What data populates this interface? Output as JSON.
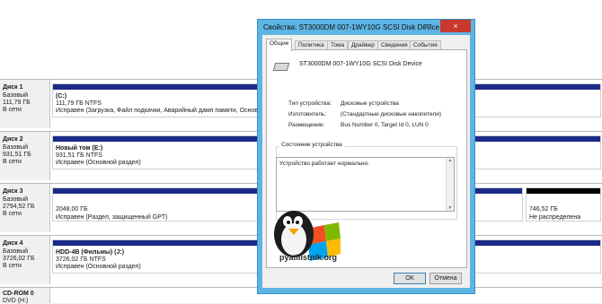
{
  "disks": [
    {
      "name": "Диск 1",
      "type": "Базовый",
      "size": "111,79 ГБ",
      "status": "В сети",
      "partitions": [
        {
          "title": "(C:)",
          "line1": "111,79 ГБ NTFS",
          "line2": "Исправен (Загрузка, Файл подкачки, Аварийный дамп памяти, Основн"
        }
      ]
    },
    {
      "name": "Диск 2",
      "type": "Базовый",
      "size": "931,51 ГБ",
      "status": "В сети",
      "partitions": [
        {
          "title": "Новый том  (E:)",
          "line1": "931,51 ГБ NTFS",
          "line2": "Исправен (Основной раздел)"
        }
      ]
    },
    {
      "name": "Диск 3",
      "type": "Базовый",
      "size": "2794,52 ГБ",
      "status": "В сети",
      "partitions": [
        {
          "title": "",
          "line1": "2048,00 ГБ",
          "line2": "Исправен (Раздел, защищенный GPT)"
        },
        {
          "title": "",
          "line1": "746,52 ГБ",
          "line2": "Не распределена"
        }
      ]
    },
    {
      "name": "Диск 4",
      "type": "Базовый",
      "size": "3726,02 ГБ",
      "status": "В сети",
      "partitions": [
        {
          "title": "HDD-4B (Фильмы)  (J:)",
          "line1": "3726,02 ГБ NTFS",
          "line2": "Исправен (Основной раздел)"
        }
      ]
    },
    {
      "name": "CD-ROM 0",
      "type": "DVD (H:)",
      "size": "",
      "status": "",
      "partitions": []
    }
  ],
  "dialog": {
    "title": "Свойства: ST3000DM 007-1WY10G SCSI Disk Device",
    "close": "×",
    "minimize": "—",
    "tabs": [
      "Общие",
      "Политика",
      "Тома",
      "Драйвер",
      "Сведения",
      "События"
    ],
    "device_name": "ST3000DM 007-1WY10G SCSI Disk Device",
    "props": [
      {
        "label": "Тип устройства:",
        "value": "Дисковые устройства"
      },
      {
        "label": "Изготовитель:",
        "value": "(Стандартные дисковые накопители)"
      },
      {
        "label": "Размещение:",
        "value": "Bus Number 0, Target Id 0, LUN 0"
      }
    ],
    "status_group_label": "Состояние устройства",
    "status_text": "Устройство работает нормально.",
    "ok": "ОК",
    "cancel": "Отмена"
  },
  "watermark": "pyatilistnik.org",
  "colors": {
    "partition_bar": "#1c2a87",
    "unallocated_bar": "#000000",
    "dialog_frame": "#5eb4e3",
    "close_button": "#c7392c"
  }
}
